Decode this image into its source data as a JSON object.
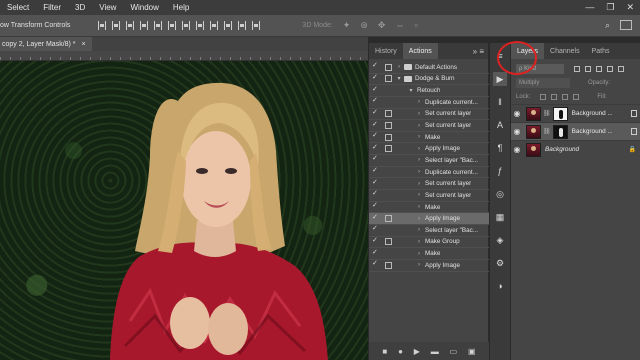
{
  "menubar": {
    "items": [
      "Select",
      "Filter",
      "3D",
      "View",
      "Window",
      "Help"
    ],
    "controls": [
      "—",
      "❐",
      "✕"
    ]
  },
  "options_bar": {
    "show_transform": "ow Transform Controls",
    "mode_3d": "3D Mode:"
  },
  "document": {
    "tab_title": "copy 2, Layer Mask/8) *",
    "tab_close": "×"
  },
  "actions_panel": {
    "tabs": [
      "History",
      "Actions"
    ],
    "menu": "»  ≡",
    "rows": [
      {
        "label": "Default Actions",
        "type": "set",
        "toggle": true
      },
      {
        "label": "Dodge & Burn",
        "type": "set",
        "toggle": true,
        "open": true
      },
      {
        "label": "Retouch",
        "type": "action",
        "toggle": false,
        "open": true
      },
      {
        "label": "Duplicate current...",
        "type": "step",
        "toggle": false
      },
      {
        "label": "Set current layer",
        "type": "step",
        "toggle": true
      },
      {
        "label": "Set current layer",
        "type": "step",
        "toggle": true
      },
      {
        "label": "Make",
        "type": "step",
        "toggle": true
      },
      {
        "label": "Apply Image",
        "type": "step",
        "toggle": true
      },
      {
        "label": "Select layer \"Bac...",
        "type": "step",
        "toggle": false
      },
      {
        "label": "Duplicate current...",
        "type": "step",
        "toggle": false
      },
      {
        "label": "Set current layer",
        "type": "step",
        "toggle": false
      },
      {
        "label": "Set current layer",
        "type": "step",
        "toggle": false
      },
      {
        "label": "Make",
        "type": "step",
        "toggle": false
      },
      {
        "label": "Apply Image",
        "type": "step",
        "toggle": true,
        "selected": true
      },
      {
        "label": "Select layer \"Bac...",
        "type": "step",
        "toggle": false
      },
      {
        "label": "Make Group",
        "type": "step",
        "toggle": true
      },
      {
        "label": "Make",
        "type": "step",
        "toggle": false
      },
      {
        "label": "Apply Image",
        "type": "step",
        "toggle": true
      }
    ],
    "footer": [
      "■",
      "●",
      "▶",
      "▬",
      "▭",
      "▣"
    ]
  },
  "tools_column": [
    "≡",
    "▶",
    "ǁ",
    "A",
    "¶",
    "ƒ",
    "◎",
    "▦",
    "◈",
    "⚙",
    "◑"
  ],
  "layers_panel": {
    "tabs": [
      "Layers",
      "Channels",
      "Paths"
    ],
    "kind_label": "ρ Kind",
    "blend_mode": "Multiply",
    "opacity_label": "Opacity:",
    "lock_label": "Lock:",
    "fill_label": "Fill:",
    "layers": [
      {
        "name": "Background ...",
        "mask": "white",
        "selected": false
      },
      {
        "name": "Background ...",
        "mask": "dark",
        "selected": true
      },
      {
        "name": "Background",
        "mask": "none",
        "selected": false,
        "locked": true
      }
    ]
  }
}
